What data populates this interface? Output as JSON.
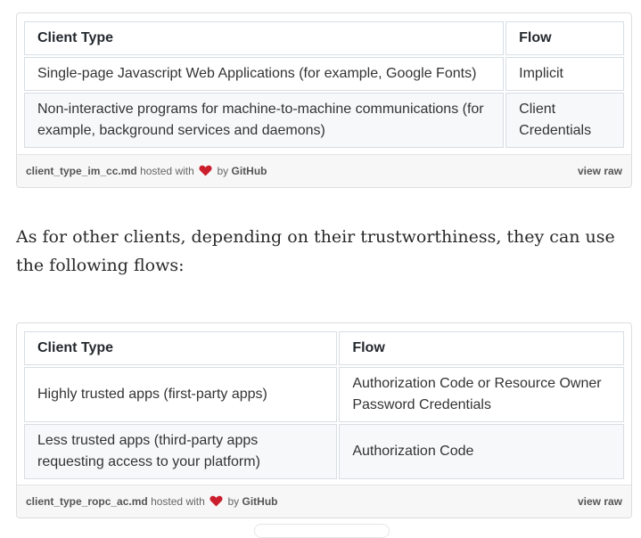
{
  "gist1": {
    "headers": [
      "Client Type",
      "Flow"
    ],
    "rows": [
      [
        "Single-page Javascript Web Applications (for example, Google Fonts)",
        "Implicit"
      ],
      [
        "Non-interactive programs for machine-to-machine communications (for example, background services and daemons)",
        "Client Credentials"
      ]
    ],
    "meta": {
      "filename": "client_type_im_cc.md",
      "hosted_with": "hosted with",
      "by": "by",
      "github": "GitHub",
      "view_raw": "view raw"
    }
  },
  "paragraph": "As for other clients, depending on their trustworthiness, they can use the following flows:",
  "gist2": {
    "headers": [
      "Client Type",
      "Flow"
    ],
    "rows": [
      [
        "Highly trusted apps (first-party apps)",
        "Authorization Code or Resource Owner Password Credentials"
      ],
      [
        "Less trusted apps (third-party apps requesting access to your platform)",
        "Authorization Code"
      ]
    ],
    "meta": {
      "filename": "client_type_ropc_ac.md",
      "hosted_with": "hosted with",
      "by": "by",
      "github": "GitHub",
      "view_raw": "view raw"
    }
  },
  "colors": {
    "heart": "#cc1f2d",
    "table_border": "#d8dee4",
    "alt_row": "#f6f8fa",
    "meta_bg": "#f7f7f7"
  },
  "icons": {
    "heart": "heart-icon"
  }
}
